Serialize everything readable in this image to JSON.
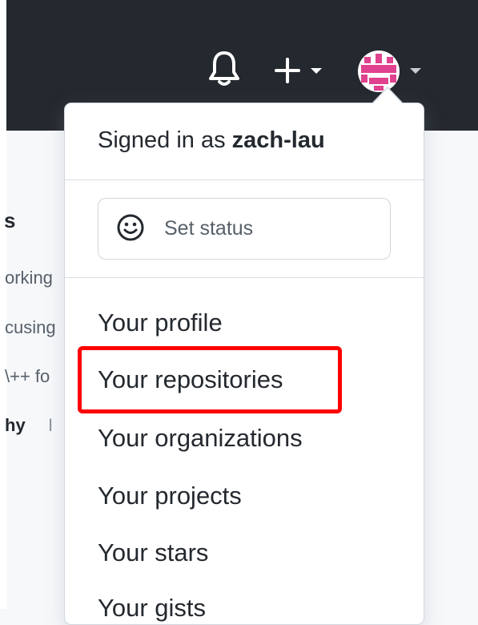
{
  "header": {
    "notifications_icon": "bell-icon",
    "create_icon": "plus-icon",
    "accent_color": "#24292f"
  },
  "background": {
    "heading": "s",
    "line1": "orking",
    "line2": "cusing",
    "line3": "\\++ fo",
    "bold_text": "hy",
    "separator": "I"
  },
  "dropdown": {
    "signed_in_prefix": "Signed in as ",
    "username": "zach-lau",
    "status_label": "Set status",
    "items": [
      {
        "label": "Your profile"
      },
      {
        "label": "Your repositories"
      },
      {
        "label": "Your organizations"
      },
      {
        "label": "Your projects"
      },
      {
        "label": "Your stars"
      },
      {
        "label": "Your gists"
      }
    ]
  },
  "highlight_color": "#ff0000"
}
